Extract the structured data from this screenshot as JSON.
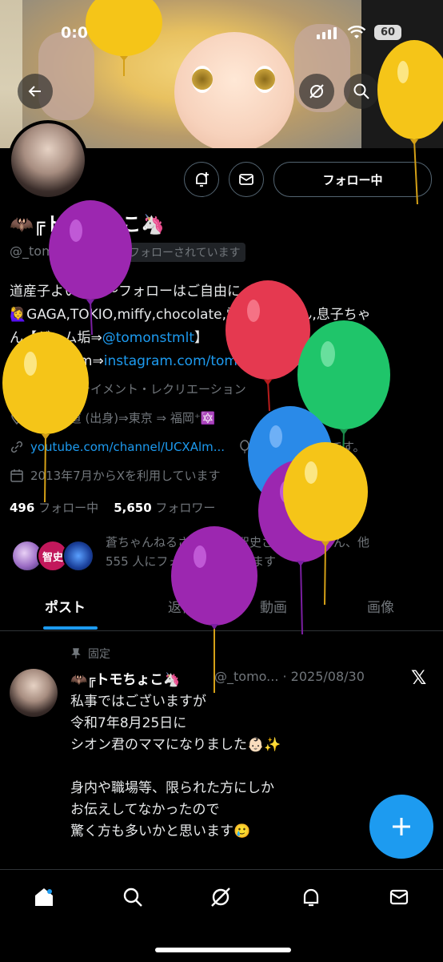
{
  "status_bar": {
    "time": "0:07",
    "battery": "60"
  },
  "profile": {
    "name": "🦇╔トモちょこ🦄",
    "handle": "@_tomomiffy",
    "follows_you": "フォローされています",
    "follow_button": "フォロー中",
    "bio_lines": [
      "道産子よいしょ〜フォローはご自由に",
      "🙋‍♀️GAGA,TOKIO,miffy,chocolate,雲丹,旦那さん,息子ちゃ",
      "ん【ゲーム垢⇒",
      "@tomonstmlt",
      "】",
      "【Instagram⇒",
      "instagram.com/tomochoco0307",
      "】"
    ],
    "category": "エンターテイメント・レクリエーション",
    "location": "🔯北海道 (出身)⇒東京 ⇒ 福岡⁺🔯",
    "website": "youtube.com/channel/UCXAlm...",
    "birthday": "今日は誕生日です。",
    "joined": "2013年7月からXを利用しています",
    "following_count": "496",
    "following_label": "フォロー中",
    "followers_count": "5,650",
    "followers_label": "フォロワー",
    "followed_by_line1": "蒼ちゃんねるさん、川内智史さん、かいさん、他",
    "followed_by_line2": "555 人にフォローされています",
    "fav_label": "智史"
  },
  "tabs": [
    "ポスト",
    "返信",
    "動画",
    "画像"
  ],
  "post": {
    "pinned_label": "固定",
    "author": "🦇╔トモちょこ🦄",
    "handle_date": "@_tomo... · 2025/08/30",
    "lines": [
      "私事ではございますが",
      "令和7年8月25日に",
      "シオン君のママになりました👶🏻✨",
      "",
      "身内や職場等、限られた方にしか",
      "お伝えしてなかったので",
      "驚く方も多いかと思います🥲"
    ]
  },
  "icons": [
    "back-arrow-icon",
    "grok-icon",
    "search-icon",
    "more-icon",
    "notification-bell-plus-icon",
    "mail-icon",
    "briefcase-icon",
    "location-pin-icon",
    "link-icon",
    "balloon-icon",
    "calendar-icon",
    "pin-icon",
    "x-logo-icon",
    "plus-icon",
    "home-icon",
    "search-icon",
    "grok-icon",
    "bell-icon",
    "mail-icon"
  ],
  "colors": {
    "accent": "#1d9bf0",
    "background": "#000000",
    "secondary_text": "#71767b"
  }
}
